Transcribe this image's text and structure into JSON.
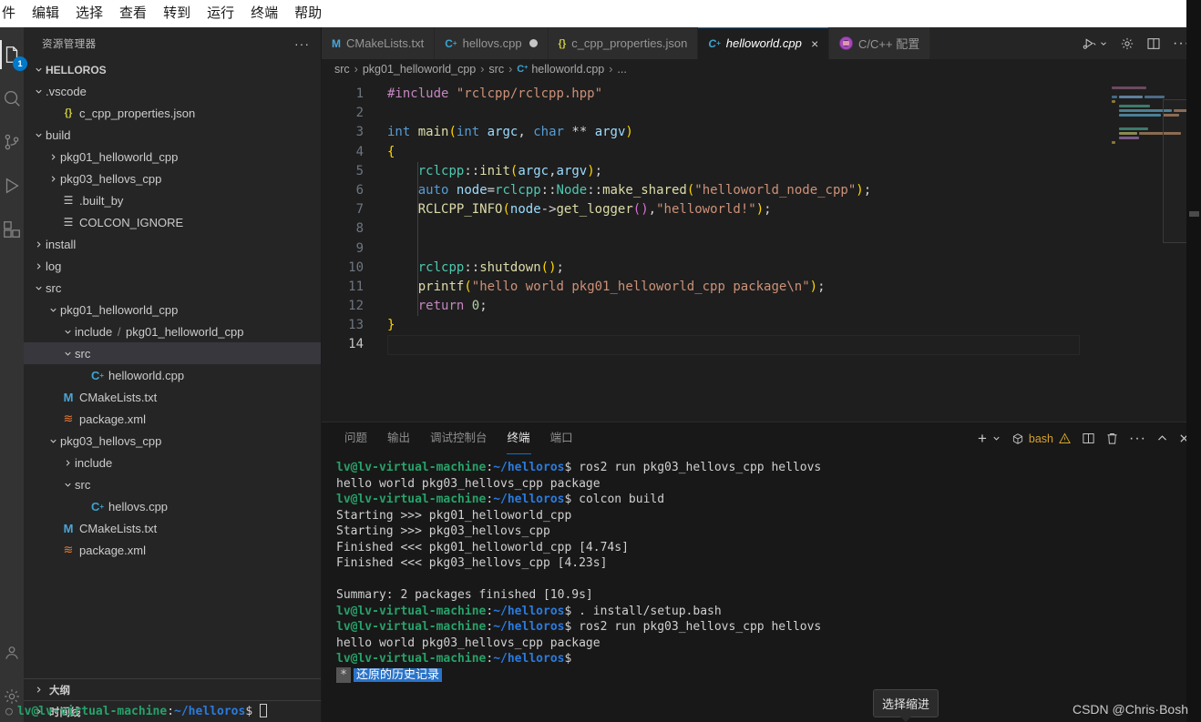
{
  "menubar": {
    "items": [
      {
        "label": "件"
      },
      {
        "label": "编辑"
      },
      {
        "label": "选择"
      },
      {
        "label": "查看"
      },
      {
        "label": "转到"
      },
      {
        "label": "运行"
      },
      {
        "label": "终端"
      },
      {
        "label": "帮助"
      }
    ]
  },
  "activitybar": {
    "items": [
      {
        "name": "explorer",
        "icon": "files-icon",
        "badge": "1",
        "active": true
      },
      {
        "name": "search",
        "icon": "search-icon",
        "badge": "",
        "active": false
      },
      {
        "name": "source-control",
        "icon": "source-control-icon",
        "badge": "",
        "active": false
      },
      {
        "name": "run-debug",
        "icon": "run-debug-icon",
        "badge": "",
        "active": false
      },
      {
        "name": "extensions",
        "icon": "extensions-icon",
        "badge": "",
        "active": false
      }
    ],
    "bottom": [
      {
        "name": "accounts",
        "icon": "account-icon"
      },
      {
        "name": "settings",
        "icon": "gear-icon"
      }
    ]
  },
  "sidebar": {
    "title": "资源管理器",
    "more_label": "···",
    "root": "HELLOROS",
    "tree": [
      {
        "label": ".vscode",
        "indent": 1,
        "twist": "down",
        "icon": "none",
        "selected": false
      },
      {
        "label": "c_cpp_properties.json",
        "indent": 2,
        "twist": "none",
        "icon": "json",
        "glyph": "{}",
        "selected": false
      },
      {
        "label": "build",
        "indent": 1,
        "twist": "down",
        "icon": "none",
        "selected": false
      },
      {
        "label": "pkg01_helloworld_cpp",
        "indent": 2,
        "twist": "right",
        "icon": "none",
        "selected": false
      },
      {
        "label": "pkg03_hellovs_cpp",
        "indent": 2,
        "twist": "right",
        "icon": "none",
        "selected": false
      },
      {
        "label": ".built_by",
        "indent": 2,
        "twist": "none",
        "icon": "file",
        "glyph": "☰",
        "selected": false
      },
      {
        "label": "COLCON_IGNORE",
        "indent": 2,
        "twist": "none",
        "icon": "file",
        "glyph": "☰",
        "selected": false
      },
      {
        "label": "install",
        "indent": 1,
        "twist": "right",
        "icon": "none",
        "selected": false
      },
      {
        "label": "log",
        "indent": 1,
        "twist": "right",
        "icon": "none",
        "selected": false
      },
      {
        "label": "src",
        "indent": 1,
        "twist": "down",
        "icon": "none",
        "selected": false
      },
      {
        "label": "pkg01_helloworld_cpp",
        "indent": 2,
        "twist": "down",
        "icon": "none",
        "selected": false
      },
      {
        "label": "include",
        "label2": "pkg01_helloworld_cpp",
        "indent": 3,
        "twist": "down",
        "icon": "none",
        "selected": false
      },
      {
        "label": "src",
        "indent": 3,
        "twist": "down",
        "icon": "none",
        "selected": true
      },
      {
        "label": "helloworld.cpp",
        "indent": 4,
        "twist": "none",
        "icon": "cpp",
        "glyph": "C",
        "selected": false
      },
      {
        "label": "CMakeLists.txt",
        "indent": 2,
        "twist": "none",
        "icon": "txtm",
        "glyph": "M",
        "selected": false
      },
      {
        "label": "package.xml",
        "indent": 2,
        "twist": "none",
        "icon": "xml",
        "glyph": "≋",
        "selected": false
      },
      {
        "label": "pkg03_hellovs_cpp",
        "indent": 2,
        "twist": "down",
        "icon": "none",
        "selected": false
      },
      {
        "label": "include",
        "indent": 3,
        "twist": "right",
        "icon": "none",
        "selected": false
      },
      {
        "label": "src",
        "indent": 3,
        "twist": "down",
        "icon": "none",
        "selected": false
      },
      {
        "label": "hellovs.cpp",
        "indent": 4,
        "twist": "none",
        "icon": "cpp",
        "glyph": "C",
        "selected": false
      },
      {
        "label": "CMakeLists.txt",
        "indent": 2,
        "twist": "none",
        "icon": "txtm",
        "glyph": "M",
        "selected": false
      },
      {
        "label": "package.xml",
        "indent": 2,
        "twist": "none",
        "icon": "xml",
        "glyph": "≋",
        "selected": false
      }
    ],
    "sections": [
      {
        "label": "大纲"
      },
      {
        "label": "时间线"
      }
    ]
  },
  "tabs": [
    {
      "label": "CMakeLists.txt",
      "icon": "txtm",
      "glyph": "M",
      "active": false,
      "dirty": false,
      "close": false
    },
    {
      "label": "hellovs.cpp",
      "icon": "cpp",
      "glyph": "C",
      "active": false,
      "dirty": true,
      "close": false
    },
    {
      "label": "c_cpp_properties.json",
      "icon": "json",
      "glyph": "{}",
      "active": false,
      "dirty": false,
      "close": false
    },
    {
      "label": "helloworld.cpp",
      "icon": "cpp",
      "glyph": "C",
      "active": true,
      "dirty": false,
      "close": true,
      "close_label": "×"
    },
    {
      "label": "C/C++ 配置",
      "icon": "cfg",
      "glyph": "",
      "active": false,
      "dirty": false,
      "close": false
    }
  ],
  "tab_actions": [
    {
      "name": "run-or-debug",
      "icon": "run-debug-caret-icon"
    },
    {
      "name": "settings",
      "icon": "gear-icon"
    },
    {
      "name": "split-editor",
      "icon": "split-editor-icon"
    },
    {
      "name": "more-actions",
      "icon": "ellipsis-icon",
      "label": "···"
    }
  ],
  "breadcrumb": [
    {
      "label": "src"
    },
    {
      "label": "pkg01_helloworld_cpp"
    },
    {
      "label": "src"
    },
    {
      "label": "helloworld.cpp",
      "icon": "cpp"
    },
    {
      "label": "..."
    }
  ],
  "editor": {
    "line_numbers": [
      "1",
      "2",
      "3",
      "4",
      "5",
      "6",
      "7",
      "8",
      "9",
      "10",
      "11",
      "12",
      "13",
      "14"
    ],
    "current_line": 14,
    "code": [
      "#include \"rclcpp/rclcpp.hpp\"",
      "",
      "int main(int argc, char ** argv)",
      "{",
      "    rclcpp::init(argc,argv);",
      "    auto node=rclcpp::Node::make_shared(\"helloworld_node_cpp\");",
      "    RCLCPP_INFO(node->get_logger(),\"helloworld!\");",
      "",
      "",
      "    rclcpp::shutdown();",
      "    printf(\"hello world pkg01_helloworld_cpp package\\n\");",
      "    return 0;",
      "}",
      ""
    ]
  },
  "panel": {
    "tabs": [
      {
        "label": "问题",
        "active": false
      },
      {
        "label": "输出",
        "active": false
      },
      {
        "label": "调试控制台",
        "active": false
      },
      {
        "label": "终端",
        "active": true
      },
      {
        "label": "端口",
        "active": false
      }
    ],
    "actions": {
      "new_terminal": "+",
      "new_terminal_caret": "⌄",
      "shell_label": "bash",
      "warning": "warning-icon",
      "split": "split-terminal-icon",
      "kill": "trash-icon",
      "more": "···",
      "maximize": "⌃",
      "close": "✕"
    },
    "terminal": {
      "user_host": "lv@lv-virtual-machine",
      "path": "~/helloros",
      "prompt_char": "$",
      "lines": [
        {
          "type": "prompt",
          "cmd": " ros2 run pkg03_hellovs_cpp hellovs"
        },
        {
          "type": "out",
          "text": "hello world pkg03_hellovs_cpp package"
        },
        {
          "type": "prompt",
          "cmd": " colcon build"
        },
        {
          "type": "out",
          "text": "Starting >>> pkg01_helloworld_cpp"
        },
        {
          "type": "out",
          "text": "Starting >>> pkg03_hellovs_cpp"
        },
        {
          "type": "out",
          "text": "Finished <<< pkg01_helloworld_cpp [4.74s]"
        },
        {
          "type": "out",
          "text": "Finished <<< pkg03_hellovs_cpp [4.23s]"
        },
        {
          "type": "out",
          "text": ""
        },
        {
          "type": "out",
          "text": "Summary: 2 packages finished [10.9s]"
        },
        {
          "type": "prompt",
          "cmd": " . install/setup.bash"
        },
        {
          "type": "prompt",
          "cmd": " ros2 run pkg03_hellovs_cpp hellovs"
        },
        {
          "type": "out",
          "text": "hello world pkg03_hellovs_cpp package"
        },
        {
          "type": "prompt",
          "cmd": ""
        },
        {
          "type": "highlight",
          "marker": "*",
          "text": "还原的历史记录"
        }
      ],
      "last_prompt_bullet": "○"
    }
  },
  "tooltip": {
    "text": "选择缩进"
  },
  "watermark": {
    "text": "CSDN @Chris·Bosh"
  },
  "colors": {
    "accent": "#0078d4",
    "terminal_green": "#26a269",
    "terminal_blue": "#2a7bde",
    "editor_bg": "#1e1e1e",
    "sidebar_bg": "#252526",
    "panel_bg": "#181818",
    "selection_blue": "#2973c9"
  }
}
